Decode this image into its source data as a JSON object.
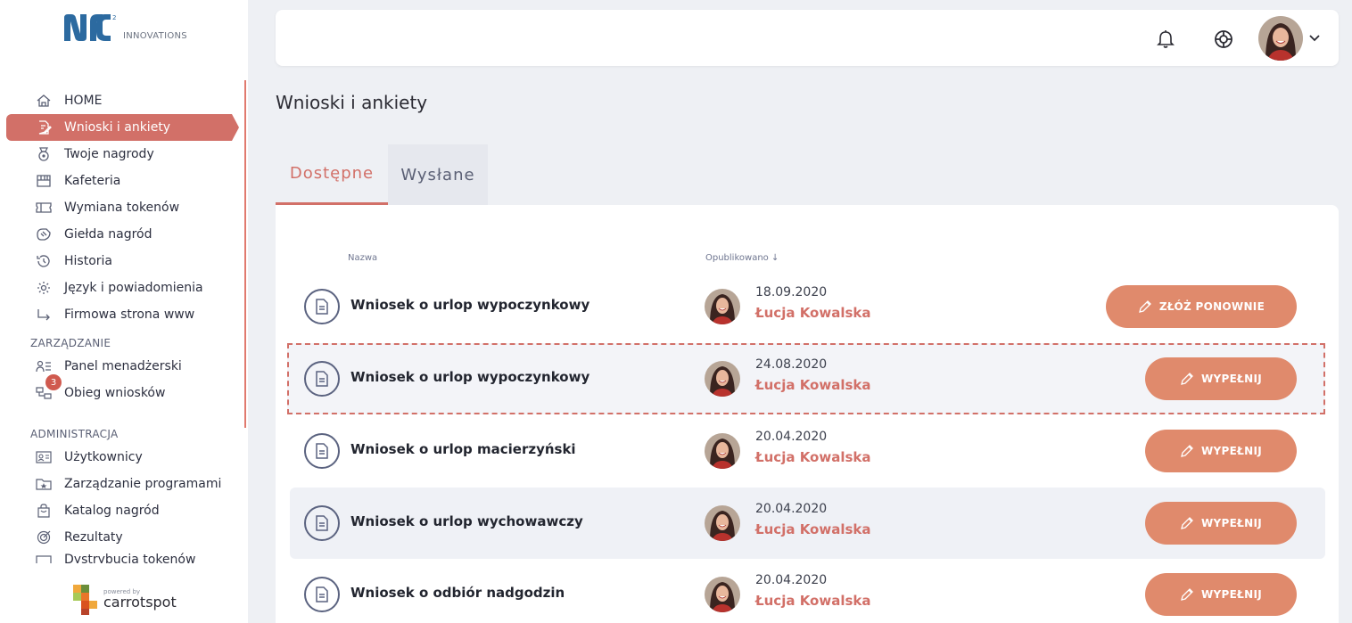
{
  "logo": {
    "text": "INNOVATIONS"
  },
  "sidebar": {
    "items": [
      {
        "label": "HOME",
        "icon": "home-icon"
      },
      {
        "label": "Wnioski i ankiety",
        "icon": "edit-doc-icon",
        "active": true
      },
      {
        "label": "Twoje nagrody",
        "icon": "medal-icon"
      },
      {
        "label": "Kafeteria",
        "icon": "store-icon"
      },
      {
        "label": "Wymiana tokenów",
        "icon": "ticket-icon"
      },
      {
        "label": "Giełda nagród",
        "icon": "handshake-icon"
      },
      {
        "label": "Historia",
        "icon": "history-icon"
      },
      {
        "label": "Język i powiadomienia",
        "icon": "settings-icon"
      },
      {
        "label": "Firmowa strona www",
        "icon": "arrow-turn-icon"
      }
    ],
    "section_management": "ZARZĄDZANIE",
    "management_items": [
      {
        "label": "Panel menadżerski",
        "icon": "manager-icon"
      },
      {
        "label": "Obieg wniosków",
        "icon": "workflow-icon",
        "badge": "3"
      }
    ],
    "section_admin": "ADMINISTRACJA",
    "admin_items": [
      {
        "label": "Użytkownicy",
        "icon": "id-card-icon"
      },
      {
        "label": "Zarządzanie programami",
        "icon": "folder-star-icon"
      },
      {
        "label": "Katalog nagród",
        "icon": "bag-icon"
      },
      {
        "label": "Rezultaty",
        "icon": "target-icon"
      },
      {
        "label": "Dystrybucja tokenów",
        "icon": "mail-icon"
      }
    ],
    "powered_by": "powered by",
    "powered_brand": "carrotspot"
  },
  "header": {
    "bell_icon": "bell-icon",
    "help_icon": "lifebuoy-icon"
  },
  "page": {
    "title": "Wnioski i ankiety"
  },
  "tabs": [
    {
      "label": "Dostępne",
      "active": true
    },
    {
      "label": "Wysłane",
      "active": false
    }
  ],
  "table": {
    "col_name": "Nazwa",
    "col_published": "Opublikowano ↓",
    "rows": [
      {
        "name": "Wniosek o urlop wypoczynkowy",
        "date": "18.09.2020",
        "author": "Łucja Kowalska",
        "action": "ZŁÓŻ PONOWNIE"
      },
      {
        "name": "Wniosek o urlop wypoczynkowy",
        "date": "24.08.2020",
        "author": "Łucja Kowalska",
        "action": "WYPEŁNIJ"
      },
      {
        "name": "Wniosek o urlop macierzyński",
        "date": "20.04.2020",
        "author": "Łucja Kowalska",
        "action": "WYPEŁNIJ"
      },
      {
        "name": "Wniosek o urlop wychowawczy",
        "date": "20.04.2020",
        "author": "Łucja Kowalska",
        "action": "WYPEŁNIJ"
      },
      {
        "name": "Wniosek o odbiór nadgodzin",
        "date": "20.04.2020",
        "author": "Łucja Kowalska",
        "action": "WYPEŁNIJ"
      }
    ]
  },
  "colors": {
    "accent": "#d27068",
    "button": "#e08a6c"
  }
}
